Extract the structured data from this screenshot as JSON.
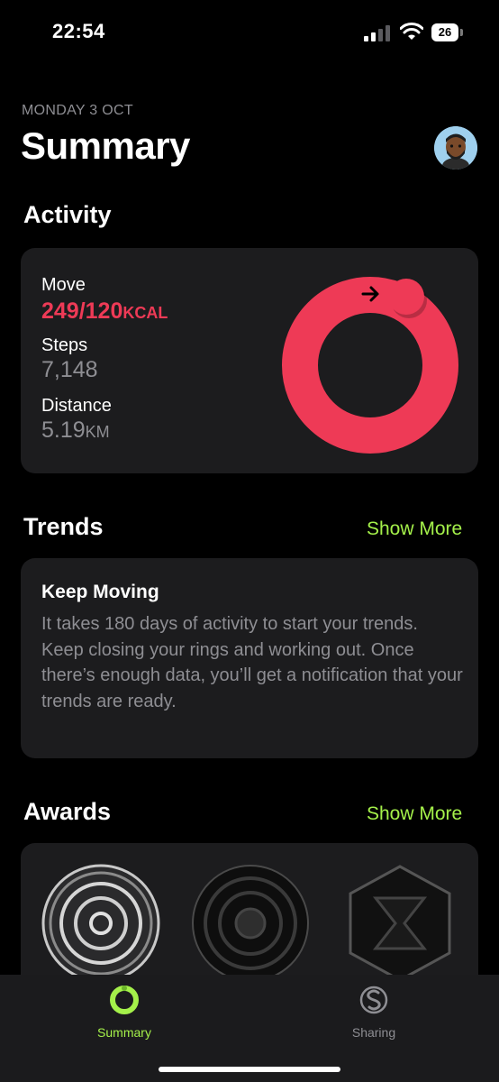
{
  "status": {
    "time": "22:54",
    "battery": "26"
  },
  "header": {
    "date": "MONDAY 3 OCT",
    "title": "Summary"
  },
  "activity": {
    "section_title": "Activity",
    "move_label": "Move",
    "move_value": "249/120",
    "move_unit": "KCAL",
    "steps_label": "Steps",
    "steps_value": "7,148",
    "distance_label": "Distance",
    "distance_value": "5.19",
    "distance_unit": "KM",
    "ring_color": "#ee3a56",
    "move_progress": 2.075
  },
  "trends": {
    "section_title": "Trends",
    "show_more": "Show More",
    "card_title": "Keep Moving",
    "card_body": "It takes 180 days of activity to start your trends. Keep closing your rings and working out. Once there’s enough data, you’ll get a notification that your trends are ready."
  },
  "awards": {
    "section_title": "Awards",
    "show_more": "Show More",
    "badges": [
      "silver-target-badge-icon",
      "dark-target-badge-icon",
      "hexagon-badge-icon"
    ]
  },
  "tabbar": {
    "tabs": [
      {
        "label": "Summary",
        "icon": "activity-ring-icon",
        "active": true,
        "color": "#a4f04a"
      },
      {
        "label": "Sharing",
        "icon": "sharing-icon",
        "active": false,
        "color": "#8e8e93"
      }
    ]
  }
}
